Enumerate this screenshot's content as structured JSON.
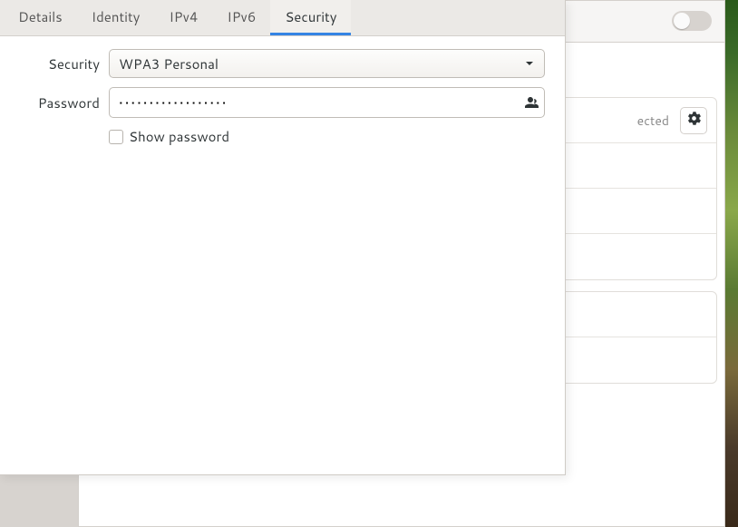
{
  "dialog": {
    "tabs": {
      "details": "Details",
      "identity": "Identity",
      "ipv4": "IPv4",
      "ipv6": "IPv6",
      "security": "Security"
    },
    "active_tab": "security",
    "security": {
      "security_label": "Security",
      "security_value": "WPA3 Personal",
      "password_label": "Password",
      "password_value": "••••••••••••••••••",
      "show_password_label": "Show password",
      "show_password_checked": false
    }
  },
  "background_window": {
    "toggle_on": false,
    "connected_text": "ected"
  }
}
